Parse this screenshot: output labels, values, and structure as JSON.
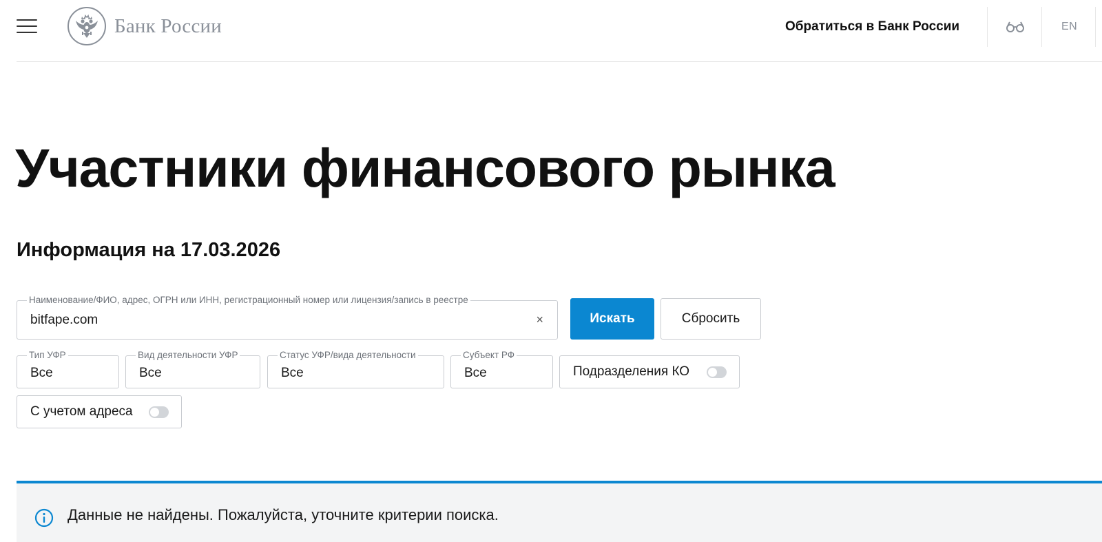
{
  "header": {
    "logo_text": "Банк России",
    "contact_link": "Обратиться в Банк России",
    "lang": "EN"
  },
  "page": {
    "title": "Участники финансового рынка",
    "info_date": "Информация на 17.03.2026"
  },
  "search": {
    "legend": "Наименование/ФИО, адрес, ОГРН или ИНН, регистрационный номер или лицензия/запись в реестре",
    "value": "bitfape.com",
    "clear": "×",
    "submit_label": "Искать",
    "reset_label": "Сбросить"
  },
  "filters": {
    "ufr_type": {
      "legend": "Тип УФР",
      "value": "Все"
    },
    "activity_type": {
      "legend": "Вид деятельности УФР",
      "value": "Все"
    },
    "status": {
      "legend": "Статус УФР/вида деятельности",
      "value": "Все"
    },
    "region": {
      "legend": "Субъект РФ",
      "value": "Все"
    },
    "ko_divisions": {
      "label": "Подразделения КО",
      "on": false
    },
    "with_address": {
      "label": "С учетом адреса",
      "on": false
    }
  },
  "notice": {
    "text": "Данные не найдены. Пожалуйста, уточните критерии поиска."
  },
  "colors": {
    "accent": "#0b87d1",
    "notice_bg": "#f3f4f5",
    "logo_gray": "#8a9099"
  },
  "icons": {
    "menu": "hamburger-menu-icon",
    "emblem": "double-headed-eagle-emblem",
    "accessibility": "glasses-icon",
    "info": "info-circle-icon"
  }
}
